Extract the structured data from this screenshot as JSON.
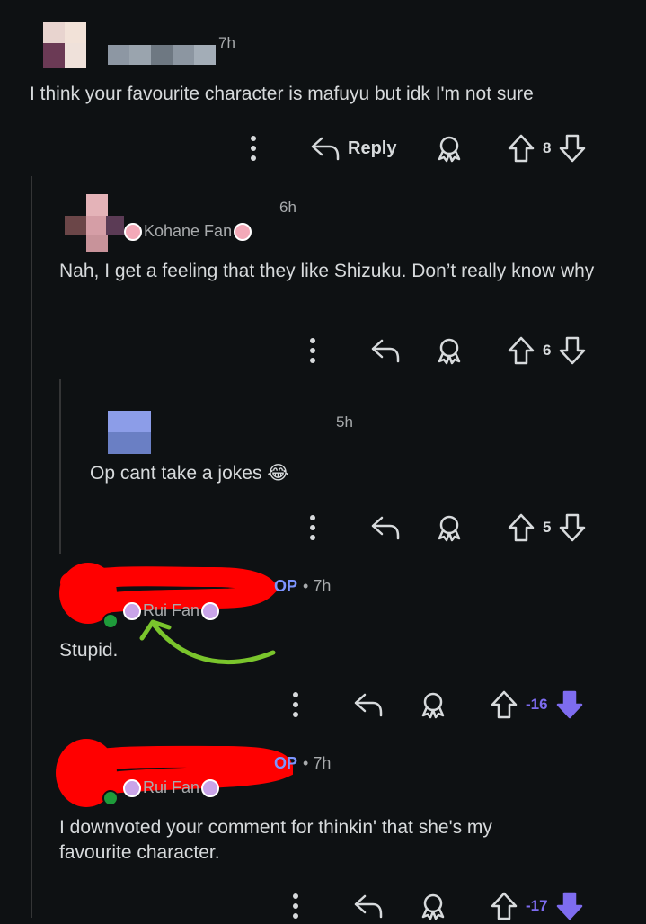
{
  "comments": [
    {
      "id": "c1",
      "time": "7h",
      "body": "I think your favourite character is mafuyu but idk I'm not sure",
      "reply_label": "Reply",
      "score": "8"
    },
    {
      "id": "c2",
      "time": "6h",
      "flair": "Kohane Fan",
      "body": "Nah, I get a feeling that they like Shizuku. Don’t really know why",
      "score": "6"
    },
    {
      "id": "c3",
      "time": "5h",
      "body": "Op cant take a jokes 😂",
      "score": "5"
    },
    {
      "id": "c4",
      "op_label": "OP",
      "time": "• 7h",
      "flair": "Rui Fan",
      "body": "Stupid.",
      "score": "-16"
    },
    {
      "id": "c5",
      "op_label": "OP",
      "time": "• 7h",
      "flair": "Rui Fan",
      "body": "I downvoted your comment for thinkin' that she's my favourite character.",
      "score": "-17"
    }
  ],
  "colors": {
    "background": "#0e1113",
    "op_accent": "#7d95ff",
    "downvote_active": "#7e6cf0",
    "redaction": "#ff0000",
    "annotation_arrow": "#7ac52c"
  },
  "icons": [
    "overflow-menu-icon",
    "reply-icon",
    "award-icon",
    "upvote-icon",
    "downvote-icon"
  ]
}
